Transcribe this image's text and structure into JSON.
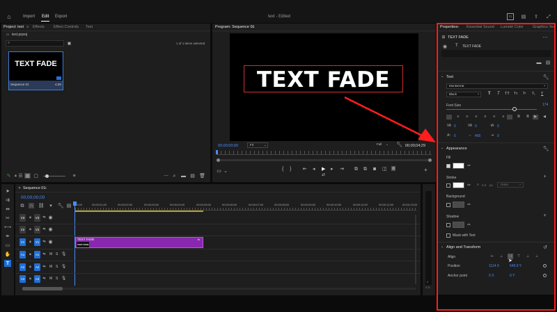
{
  "menu": {
    "import": "Import",
    "edit": "Edit",
    "export": "Export",
    "title": "text - Edited"
  },
  "project_panel": {
    "tabs": [
      "Project: text",
      "Effects",
      "Effect Controls",
      "Text"
    ],
    "project_file": "text.prproj",
    "items_selected": "1 of 1 items selected",
    "clip_title": "TEXT FADE",
    "clip_name": "Sequence 01",
    "clip_duration": "4;29"
  },
  "program": {
    "tab": "Program: Sequence 01",
    "canvas_text": "TEXT FADE",
    "timecode": "00;00;00;00",
    "fit": "Fit",
    "quality": "Full",
    "duration": "00;00;04;29"
  },
  "timeline": {
    "tab": "Sequence 01",
    "timecode": "00;00;00;00",
    "ruler": [
      "00;00",
      "00;00;01;00",
      "00;00;02;00",
      "00;00;03;00",
      "00;00;04;00",
      "00;00;05;00",
      "00;00;06;00",
      "00;00;07;00",
      "00;00;08;00",
      "00;00;09;00",
      "00;00;10;00",
      "00;00;11;00",
      "00;00;12;00",
      "00;00;13;00"
    ],
    "tracks": [
      "V3",
      "V2",
      "V1",
      "A1",
      "A2",
      "A3"
    ],
    "src_tracks": [
      "V1",
      "A1",
      "A2",
      "A3"
    ],
    "clip_label": "TEXT FADE",
    "clip_thumb": "TEXT FADE",
    "clip_fx": "fx",
    "meter_labels": [
      "0",
      "S S"
    ]
  },
  "properties": {
    "tabs": [
      "Properties",
      "Essential Sound",
      "Lumetri Color",
      "Graphics Tex"
    ],
    "header": "TEXT FADE",
    "layer_name": "TEXT FADE",
    "text_section": "Text",
    "font": "Montserrat",
    "weight": "Black",
    "font_size_label": "Font Size",
    "font_size": "174",
    "tracking_value": "0",
    "kerning_value": "0",
    "leading_value": "0",
    "baseline_value": "0",
    "tsume_value": "400",
    "tsume2_value": "0",
    "appearance_section": "Appearance",
    "fill_label": "Fill",
    "stroke_label": "Stroke",
    "stroke_width": "4.0",
    "stroke_unit": "px",
    "stroke_type": "Outer",
    "background_label": "Background",
    "shadow_label": "Shadow",
    "mask_label": "Mask with Text",
    "align_section": "Align and Transform",
    "align_label": "Align",
    "position_label": "Position",
    "position_x": "1114 X",
    "position_y": "549.9 Y",
    "anchor_label": "Anchor point",
    "anchor_x": "0 X",
    "anchor_y": "0 Y"
  },
  "colors": {
    "accent": "#4a8dff",
    "clip": "#8a27b0",
    "highlight_box": "#ff1e1e",
    "track_button": "#1f6fd6"
  }
}
